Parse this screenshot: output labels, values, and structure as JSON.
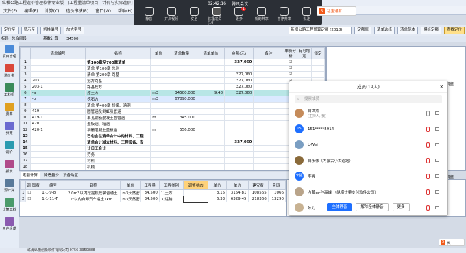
{
  "title_bar": "纵横公路工程造价管理软件专业版 - [工程量清单项目 - 计价与实际造价]",
  "menu": [
    "文件(F)",
    "编辑(E)",
    "计算(C)",
    "造价审核(R)",
    "窗口(W)",
    "帮助(H)"
  ],
  "meeting": {
    "time": "02:42:16",
    "name": "腾讯会议",
    "buttons": [
      {
        "label": "静音",
        "icon": "microphone-icon"
      },
      {
        "label": "开启视频",
        "icon": "camera-icon"
      },
      {
        "label": "安全",
        "icon": "shield-icon"
      },
      {
        "label": "管理成员(19)",
        "icon": "members-icon"
      },
      {
        "label": "更多",
        "icon": "more-icon"
      },
      {
        "label": "新的共享",
        "icon": "share-icon"
      },
      {
        "label": "暂停共享",
        "icon": "pause-icon"
      },
      {
        "label": "批注",
        "icon": "annotate-icon"
      }
    ],
    "more_badge": "1"
  },
  "ime": {
    "label": "钻宝通有",
    "status": "英"
  },
  "toolbar": {
    "items": [
      "定位至",
      "显示至",
      "切换编号",
      "放大字号"
    ],
    "combo": "新增公路工程预算定额 (2018)",
    "buttons": [
      "定额库",
      "清单选择",
      "清单范本",
      "模板定额"
    ],
    "active_button": "查找定位"
  },
  "tree_tabs": [
    "标段",
    "总合同段"
  ],
  "node": "基数计算",
  "node_value": "34500",
  "sidebar": [
    {
      "label": "项目管理",
      "icon": "folder-icon"
    },
    {
      "label": "造价书",
      "icon": "book-icon"
    },
    {
      "label": "工料机",
      "icon": "tools-icon"
    },
    {
      "label": "费率",
      "icon": "rate-icon"
    },
    {
      "label": "分摊",
      "icon": "split-icon"
    },
    {
      "label": "调价",
      "icon": "adjust-icon"
    },
    {
      "label": "报表",
      "icon": "report-icon"
    },
    {
      "label": "源计算",
      "icon": "calc-icon"
    },
    {
      "label": "计算工料",
      "icon": "calc-icon"
    },
    {
      "label": "用户组成",
      "icon": "users-icon"
    }
  ],
  "grid": {
    "columns": [
      "清单编号",
      "名称",
      "单位",
      "清单数量",
      "清单单价",
      "金额(元)",
      "备注",
      "单价分析",
      "有可增定",
      "锁定"
    ],
    "rows": [
      {
        "n": "1",
        "code": "",
        "name": "第100章至700章清单",
        "unit": "",
        "qty": "",
        "price": "",
        "amount": "327,060",
        "bold": true
      },
      {
        "n": "2",
        "code": "",
        "name": "清单 第100章 总则",
        "unit": "",
        "qty": "",
        "price": "",
        "amount": "",
        "bold": false
      },
      {
        "n": "3",
        "code": "",
        "name": "清单 第200章 路基",
        "unit": "",
        "qty": "",
        "price": "",
        "amount": "327,060",
        "bold": false
      },
      {
        "n": "4",
        "code": "203",
        "name": "挖方路基",
        "unit": "",
        "qty": "",
        "price": "",
        "amount": "327,060",
        "bold": false
      },
      {
        "n": "5",
        "code": "203-1",
        "name": "路基挖方",
        "unit": "",
        "qty": "",
        "price": "",
        "amount": "327,060",
        "bold": false
      },
      {
        "n": "6",
        "code": "-a",
        "name": "挖土方",
        "unit": "m3",
        "qty": "34500.000",
        "price": "9.48",
        "amount": "327,060",
        "bold": false,
        "hl": true
      },
      {
        "n": "7",
        "code": "-b",
        "name": "挖石方",
        "unit": "m3",
        "qty": "67890.000",
        "price": "",
        "amount": "",
        "bold": false
      },
      {
        "n": "8",
        "code": "",
        "name": "清单 第400章 桥梁、涵洞",
        "unit": "",
        "qty": "",
        "price": "",
        "amount": "",
        "bold": false
      },
      {
        "n": "9",
        "code": "419",
        "name": "圆管涵及倒虹吸管涵",
        "unit": "",
        "qty": "",
        "price": "",
        "amount": "",
        "bold": false
      },
      {
        "n": "10",
        "code": "419-1",
        "name": "单孔钢筋混凝土圆管涵",
        "unit": "m",
        "qty": "345.000",
        "price": "",
        "amount": "",
        "bold": false
      },
      {
        "n": "11",
        "code": "420",
        "name": "盖板涵、箱涵",
        "unit": "",
        "qty": "",
        "price": "",
        "amount": "",
        "bold": false
      },
      {
        "n": "12",
        "code": "420-1",
        "name": "钢筋混凝土盖板涵",
        "unit": "m",
        "qty": "556.000",
        "price": "",
        "amount": "",
        "bold": false
      },
      {
        "n": "13",
        "code": "",
        "name": "已包含在清单合计中的材料、工程",
        "unit": "",
        "qty": "",
        "price": "",
        "amount": "",
        "bold": true
      },
      {
        "n": "14",
        "code": "",
        "name": "清单合计减去材料、工程设备、专",
        "unit": "",
        "qty": "",
        "price": "",
        "amount": "327,060",
        "bold": true
      },
      {
        "n": "15",
        "code": "",
        "name": "计日工合计",
        "unit": "",
        "qty": "",
        "price": "",
        "amount": "",
        "bold": true
      },
      {
        "n": "16",
        "code": "",
        "name": "劳务",
        "unit": "",
        "qty": "",
        "price": "",
        "amount": "",
        "bold": false
      },
      {
        "n": "17",
        "code": "",
        "name": "材料",
        "unit": "",
        "qty": "",
        "price": "",
        "amount": "",
        "bold": false
      },
      {
        "n": "18",
        "code": "",
        "name": "机械",
        "unit": "",
        "qty": "",
        "price": "",
        "amount": "",
        "bold": false
      },
      {
        "n": "19",
        "code": "",
        "name": "暂列金额（不含计日工总额）",
        "unit": "",
        "qty": "",
        "price": "",
        "amount": "",
        "bold": true
      },
      {
        "n": "20",
        "code": "",
        "name": "投标报价",
        "unit": "",
        "qty": "",
        "price": "",
        "amount": "327,060",
        "bold": true
      }
    ]
  },
  "subtabs": [
    "定额计算",
    "降造量价",
    "设备购置"
  ],
  "grid2": {
    "columns": [
      "",
      "调",
      "取费",
      "编号",
      "名称",
      "单位",
      "工程量",
      "工程类别",
      "调整状态",
      "单价",
      "单价",
      "建安费",
      "利润"
    ],
    "rows": [
      {
        "n": "1",
        "code": "1-1-9-8",
        "name": "2.0m3以内挖掘机挖装普通土",
        "unit": "m3天然密实",
        "qty": "34.500",
        "cls": "1)土方",
        "p1": "3.15",
        "p2": "3154.81",
        "fee": "108565",
        "profit": "1066"
      },
      {
        "n": "2",
        "code": "1-1-11-T",
        "name": "12t以内自卸汽车运土1km",
        "unit": "m3天然密实",
        "qty": "34.500",
        "cls": "3)运输",
        "p1": "6.33",
        "p2": "6329.45",
        "fee": "218366",
        "profit": "13290"
      }
    ]
  },
  "right_labels": [
    "定额调整",
    "定额调整"
  ],
  "members": {
    "title": "成员(19人)",
    "search_placeholder": "搜索成员",
    "list": [
      {
        "name": "白世杰",
        "sub": "(主持人, 我)",
        "avatar_color": "#c58b5a",
        "mic": "on",
        "cam": "on"
      },
      {
        "name": "151*****5914",
        "sub": "",
        "avatar_color": "#1e6fff",
        "avatar_text": "15",
        "mic": "off",
        "cam": "off"
      },
      {
        "name": "L-Wei",
        "sub": "",
        "avatar_color": "#7a9ec2",
        "mic": "off",
        "cam": "off"
      },
      {
        "name": "白永伟（内蒙古小古道路）",
        "sub": "",
        "avatar_color": "#8a6a3a",
        "mic": "off",
        "cam": "off"
      },
      {
        "name": "李强",
        "sub": "",
        "avatar_color": "#1e6fff",
        "avatar_text": "李强",
        "mic": "off",
        "cam": "off"
      },
      {
        "name": "内蒙古-孙高峰 （纵横计量支付软件公司）",
        "sub": "",
        "avatar_color": "#b9a48a",
        "mic": "off",
        "cam": "off"
      },
      {
        "name": "陈力",
        "sub": "",
        "avatar_color": "#c8b292",
        "mic": "off",
        "cam": "off"
      }
    ],
    "buttons": {
      "mute_all": "全体静音",
      "unmute_all": "解除全体静音",
      "more": "更多"
    }
  },
  "statusbar": "珠海纵横创新软件有限公司  0756-3350888"
}
